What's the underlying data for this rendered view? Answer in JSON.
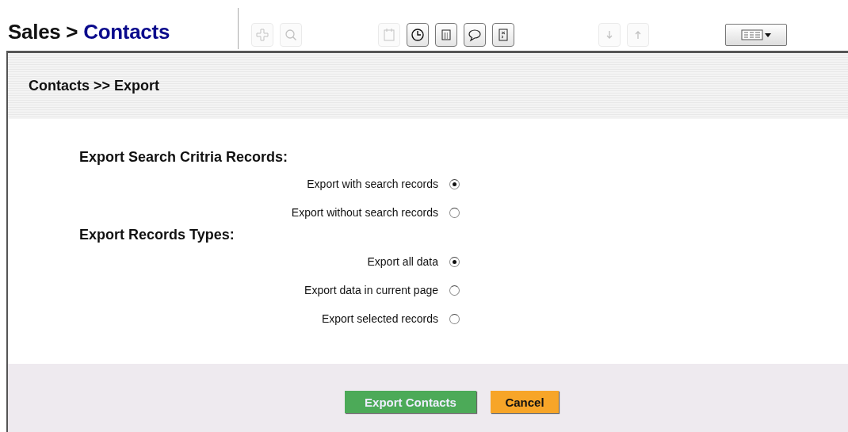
{
  "header": {
    "section": "Sales >",
    "module": "Contacts"
  },
  "toolbar": [
    {
      "kind": "plus",
      "disabled": true
    },
    {
      "kind": "search",
      "disabled": true
    },
    {
      "kind": "gap"
    },
    {
      "kind": "calendar",
      "disabled": true
    },
    {
      "kind": "clock",
      "disabled": false
    },
    {
      "kind": "calculator",
      "disabled": false
    },
    {
      "kind": "bubble",
      "disabled": false
    },
    {
      "kind": "notes",
      "disabled": false
    },
    {
      "kind": "gap"
    },
    {
      "kind": "down",
      "disabled": true
    },
    {
      "kind": "up",
      "disabled": true
    },
    {
      "kind": "gap"
    },
    {
      "kind": "columns",
      "disabled": false
    }
  ],
  "panel_title": "Contacts >> Export",
  "groups": [
    {
      "heading": "Export Search Critria Records:",
      "options": [
        {
          "label": "Export with search records",
          "selected": true
        },
        {
          "label": "Export without search records",
          "selected": false
        }
      ]
    },
    {
      "heading": "Export Records Types:",
      "options": [
        {
          "label": "Export all data",
          "selected": true
        },
        {
          "label": "Export data in current page",
          "selected": false
        },
        {
          "label": "Export selected records",
          "selected": false
        }
      ]
    }
  ],
  "buttons": [
    {
      "label": "Export Contacts",
      "kind": "primary"
    },
    {
      "label": "Cancel",
      "kind": "cancel"
    }
  ]
}
